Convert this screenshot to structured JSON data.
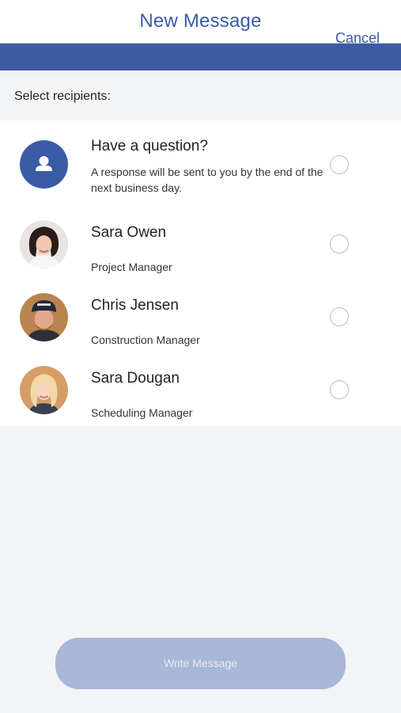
{
  "header": {
    "title": "New Message",
    "cancel_label": "Cancel"
  },
  "section": {
    "label": "Select recipients:"
  },
  "recipients": [
    {
      "name": "Have a question?",
      "description": "A response will be sent to you by the end of the next business day.",
      "avatar_icon": "person-icon",
      "selected": false
    },
    {
      "name": "Sara Owen",
      "description": "Project Manager",
      "avatar_icon": "photo",
      "selected": false
    },
    {
      "name": "Chris Jensen",
      "description": "Construction Manager",
      "avatar_icon": "photo",
      "selected": false
    },
    {
      "name": "Sara Dougan",
      "description": "Scheduling Manager",
      "avatar_icon": "photo",
      "selected": false
    }
  ],
  "footer": {
    "write_label": "Write Message"
  },
  "colors": {
    "brand": "#3d5aa4",
    "button_disabled": "#a9b7d8",
    "background": "#f3f4f6"
  }
}
